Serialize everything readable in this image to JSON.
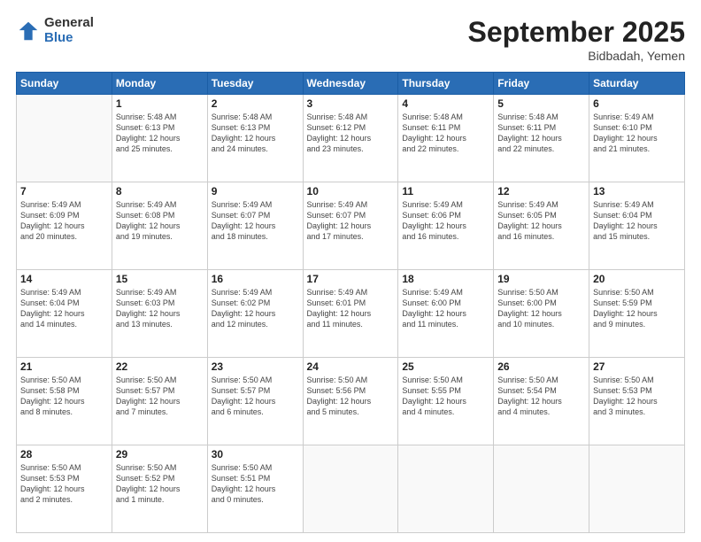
{
  "header": {
    "logo_general": "General",
    "logo_blue": "Blue",
    "month_title": "September 2025",
    "location": "Bidbadah, Yemen"
  },
  "weekdays": [
    "Sunday",
    "Monday",
    "Tuesday",
    "Wednesday",
    "Thursday",
    "Friday",
    "Saturday"
  ],
  "weeks": [
    [
      {
        "day": "",
        "info": ""
      },
      {
        "day": "1",
        "info": "Sunrise: 5:48 AM\nSunset: 6:13 PM\nDaylight: 12 hours\nand 25 minutes."
      },
      {
        "day": "2",
        "info": "Sunrise: 5:48 AM\nSunset: 6:13 PM\nDaylight: 12 hours\nand 24 minutes."
      },
      {
        "day": "3",
        "info": "Sunrise: 5:48 AM\nSunset: 6:12 PM\nDaylight: 12 hours\nand 23 minutes."
      },
      {
        "day": "4",
        "info": "Sunrise: 5:48 AM\nSunset: 6:11 PM\nDaylight: 12 hours\nand 22 minutes."
      },
      {
        "day": "5",
        "info": "Sunrise: 5:48 AM\nSunset: 6:11 PM\nDaylight: 12 hours\nand 22 minutes."
      },
      {
        "day": "6",
        "info": "Sunrise: 5:49 AM\nSunset: 6:10 PM\nDaylight: 12 hours\nand 21 minutes."
      }
    ],
    [
      {
        "day": "7",
        "info": "Sunrise: 5:49 AM\nSunset: 6:09 PM\nDaylight: 12 hours\nand 20 minutes."
      },
      {
        "day": "8",
        "info": "Sunrise: 5:49 AM\nSunset: 6:08 PM\nDaylight: 12 hours\nand 19 minutes."
      },
      {
        "day": "9",
        "info": "Sunrise: 5:49 AM\nSunset: 6:07 PM\nDaylight: 12 hours\nand 18 minutes."
      },
      {
        "day": "10",
        "info": "Sunrise: 5:49 AM\nSunset: 6:07 PM\nDaylight: 12 hours\nand 17 minutes."
      },
      {
        "day": "11",
        "info": "Sunrise: 5:49 AM\nSunset: 6:06 PM\nDaylight: 12 hours\nand 16 minutes."
      },
      {
        "day": "12",
        "info": "Sunrise: 5:49 AM\nSunset: 6:05 PM\nDaylight: 12 hours\nand 16 minutes."
      },
      {
        "day": "13",
        "info": "Sunrise: 5:49 AM\nSunset: 6:04 PM\nDaylight: 12 hours\nand 15 minutes."
      }
    ],
    [
      {
        "day": "14",
        "info": "Sunrise: 5:49 AM\nSunset: 6:04 PM\nDaylight: 12 hours\nand 14 minutes."
      },
      {
        "day": "15",
        "info": "Sunrise: 5:49 AM\nSunset: 6:03 PM\nDaylight: 12 hours\nand 13 minutes."
      },
      {
        "day": "16",
        "info": "Sunrise: 5:49 AM\nSunset: 6:02 PM\nDaylight: 12 hours\nand 12 minutes."
      },
      {
        "day": "17",
        "info": "Sunrise: 5:49 AM\nSunset: 6:01 PM\nDaylight: 12 hours\nand 11 minutes."
      },
      {
        "day": "18",
        "info": "Sunrise: 5:49 AM\nSunset: 6:00 PM\nDaylight: 12 hours\nand 11 minutes."
      },
      {
        "day": "19",
        "info": "Sunrise: 5:50 AM\nSunset: 6:00 PM\nDaylight: 12 hours\nand 10 minutes."
      },
      {
        "day": "20",
        "info": "Sunrise: 5:50 AM\nSunset: 5:59 PM\nDaylight: 12 hours\nand 9 minutes."
      }
    ],
    [
      {
        "day": "21",
        "info": "Sunrise: 5:50 AM\nSunset: 5:58 PM\nDaylight: 12 hours\nand 8 minutes."
      },
      {
        "day": "22",
        "info": "Sunrise: 5:50 AM\nSunset: 5:57 PM\nDaylight: 12 hours\nand 7 minutes."
      },
      {
        "day": "23",
        "info": "Sunrise: 5:50 AM\nSunset: 5:57 PM\nDaylight: 12 hours\nand 6 minutes."
      },
      {
        "day": "24",
        "info": "Sunrise: 5:50 AM\nSunset: 5:56 PM\nDaylight: 12 hours\nand 5 minutes."
      },
      {
        "day": "25",
        "info": "Sunrise: 5:50 AM\nSunset: 5:55 PM\nDaylight: 12 hours\nand 4 minutes."
      },
      {
        "day": "26",
        "info": "Sunrise: 5:50 AM\nSunset: 5:54 PM\nDaylight: 12 hours\nand 4 minutes."
      },
      {
        "day": "27",
        "info": "Sunrise: 5:50 AM\nSunset: 5:53 PM\nDaylight: 12 hours\nand 3 minutes."
      }
    ],
    [
      {
        "day": "28",
        "info": "Sunrise: 5:50 AM\nSunset: 5:53 PM\nDaylight: 12 hours\nand 2 minutes."
      },
      {
        "day": "29",
        "info": "Sunrise: 5:50 AM\nSunset: 5:52 PM\nDaylight: 12 hours\nand 1 minute."
      },
      {
        "day": "30",
        "info": "Sunrise: 5:50 AM\nSunset: 5:51 PM\nDaylight: 12 hours\nand 0 minutes."
      },
      {
        "day": "",
        "info": ""
      },
      {
        "day": "",
        "info": ""
      },
      {
        "day": "",
        "info": ""
      },
      {
        "day": "",
        "info": ""
      }
    ]
  ]
}
